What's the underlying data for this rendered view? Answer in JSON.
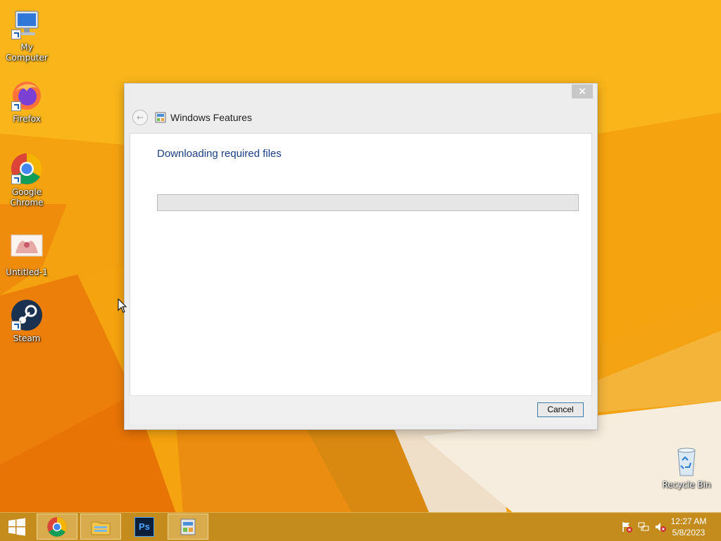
{
  "desktop": {
    "icons": [
      {
        "label": "My Computer"
      },
      {
        "label": "Firefox"
      },
      {
        "label": "Google Chrome"
      },
      {
        "label": "Untitled-1"
      },
      {
        "label": "Steam"
      },
      {
        "label": "Recycle Bin"
      }
    ]
  },
  "dialog": {
    "title": "Windows Features",
    "heading": "Downloading required files",
    "progress_percent": 0,
    "close_label": "×",
    "back_label": "←",
    "cancel_label": "Cancel"
  },
  "taskbar": {
    "items": [
      "start-icon",
      "chrome-icon",
      "file-explorer-icon",
      "photoshop-icon",
      "windows-features-icon"
    ],
    "photoshop_label": "Ps",
    "tray_icons": [
      "action-center-flag-icon",
      "network-icon",
      "volume-muted-icon"
    ],
    "clock": {
      "time": "12:27 AM",
      "date": "5/8/2023"
    }
  },
  "colors": {
    "wallpaper": "#f6a40f",
    "heading": "#1c3f86",
    "taskbar": "#be8a1e"
  }
}
